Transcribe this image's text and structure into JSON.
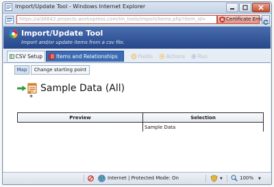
{
  "browser": {
    "window_title": "Import/Update Tool - Windows Internet Explorer",
    "url": "https://al38842.projects.workxpress.com/im_tools/import/items.php?item_id=",
    "certificate_warning": "Certificate Error",
    "status_zone": "Internet | Protected Mode: On",
    "zoom": "100%"
  },
  "tool": {
    "title": "Import/Update Tool",
    "subtitle": "Import and/or update items from a csv file."
  },
  "tabs": [
    {
      "label": "CSV Setup",
      "state": "normal"
    },
    {
      "label": "Items and Relationships",
      "state": "active"
    },
    {
      "label": "Fields",
      "state": "disabled"
    },
    {
      "label": "Actions",
      "state": "disabled"
    },
    {
      "label": "Run",
      "state": "disabled"
    }
  ],
  "subtabs": [
    {
      "label": "Map",
      "state": "active"
    },
    {
      "label": "Change starting point",
      "state": "normal"
    }
  ],
  "datasource": {
    "title": "Sample Data (All)",
    "marker": "*"
  },
  "table": {
    "headers": [
      "Preview",
      "Selection"
    ],
    "rows": [
      [
        "",
        "Sample Data"
      ]
    ]
  },
  "colors": {
    "header_blue": "#26478a",
    "active_tab": "#3a6bb3",
    "cert_error": "#c14a3b"
  }
}
